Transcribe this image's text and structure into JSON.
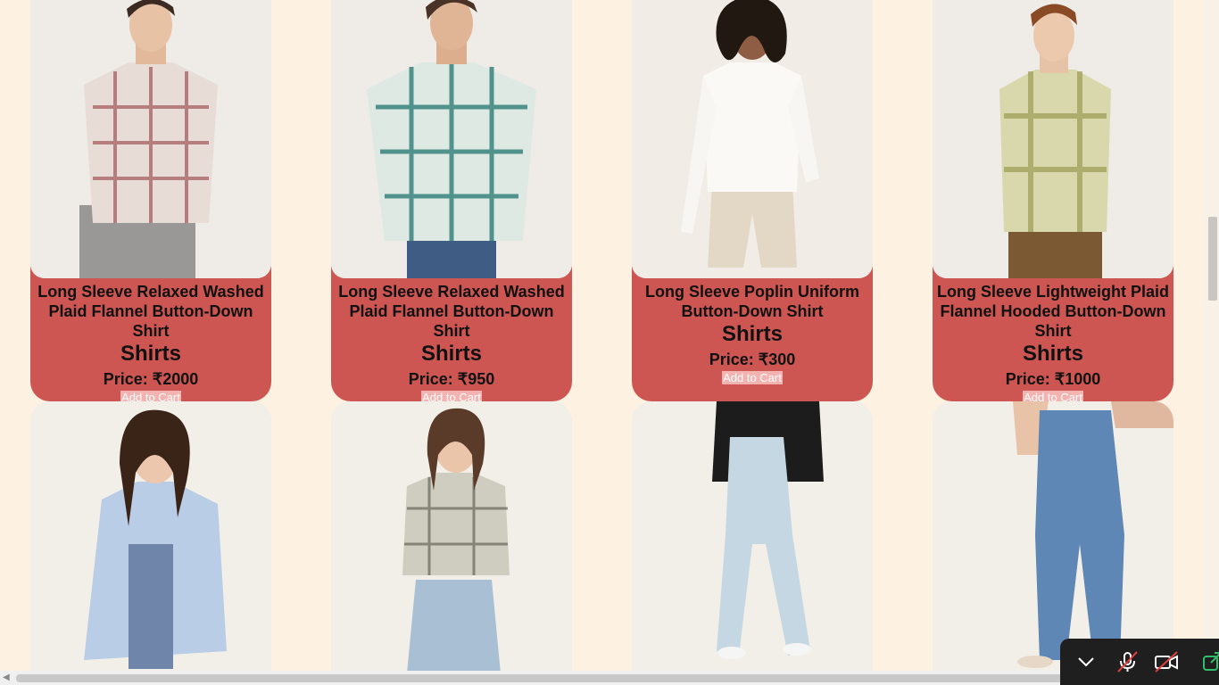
{
  "products": [
    {
      "name": "Long Sleeve Relaxed Washed Plaid Flannel Button-Down Shirt",
      "category": "Shirts",
      "price": "Price: ₹2000",
      "button": "Add to Cart"
    },
    {
      "name": "Long Sleeve Relaxed Washed Plaid Flannel Button-Down Shirt",
      "category": "Shirts",
      "price": "Price: ₹950",
      "button": "Add to Cart"
    },
    {
      "name": "Long Sleeve Poplin Uniform Button-Down Shirt",
      "category": "Shirts",
      "price": "Price: ₹300",
      "button": "Add to Cart"
    },
    {
      "name": "Long Sleeve Lightweight Plaid Flannel Hooded Button-Down Shirt",
      "category": "Shirts",
      "price": "Price: ₹1000",
      "button": "Add to Cart"
    }
  ],
  "colors": {
    "page_bg": "#fdf2e1",
    "card_bg": "#cd5652",
    "button_bg": "#f3b4b1"
  },
  "call_controls": {
    "icons": [
      "chevron-down-icon",
      "microphone-muted-icon",
      "camera-off-icon",
      "share-icon"
    ]
  }
}
